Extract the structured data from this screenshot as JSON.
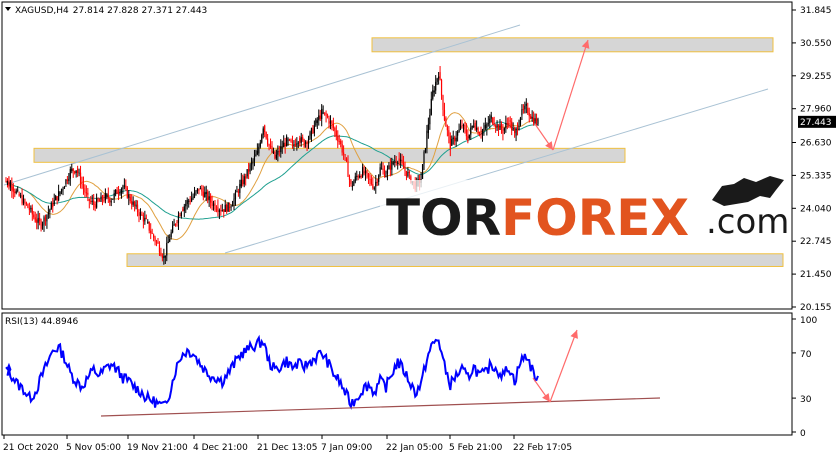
{
  "header": {
    "symbol": "XAGUSD,H4",
    "ohlc": "27.814 27.828 27.371 27.443"
  },
  "rsi_header": "RSI(13) 44.8946",
  "watermark": {
    "part1": "TOR",
    "part2": "FOREX",
    "part3": ".com"
  },
  "colors": {
    "candle_up": "#000000",
    "candle_down": "#ff0000",
    "ma_fast": "#e0a040",
    "ma_slow": "#20a090",
    "rsi_line": "#0000ff",
    "channel": "#a9c2d4",
    "zone_fill": "#d6d6d6",
    "zone_border": "#f0c040",
    "arrow": "#ff6b6b",
    "rsi_support": "#a05050",
    "logo_accent": "#e2541f"
  },
  "chart_data": [
    {
      "type": "candlestick",
      "symbol": "XAGUSD",
      "timeframe": "H4",
      "x_ticks": [
        "21 Oct 2020",
        "5 Nov 05:00",
        "19 Nov 21:00",
        "4 Dec 21:00",
        "21 Dec 13:05",
        "7 Jan 09:00",
        "22 Jan 05:00",
        "5 Feb 21:00",
        "22 Feb 17:05"
      ],
      "y_ticks": [
        "31.845",
        "30.550",
        "29.255",
        "27.960",
        "26.630",
        "25.335",
        "24.040",
        "22.745",
        "21.450",
        "20.155"
      ],
      "ylim": [
        20.155,
        31.845
      ],
      "current_price": "27.443",
      "close_series": [
        25.1,
        24.9,
        24.6,
        24.3,
        24.0,
        23.6,
        23.4,
        23.8,
        24.2,
        24.6,
        25.0,
        25.5,
        25.6,
        25.0,
        24.4,
        24.2,
        24.3,
        24.5,
        24.4,
        24.7,
        24.9,
        24.5,
        24.1,
        23.8,
        23.5,
        23.0,
        22.6,
        22.1,
        22.9,
        23.5,
        24.0,
        24.3,
        24.5,
        24.8,
        24.6,
        24.3,
        24.1,
        24.0,
        24.1,
        24.4,
        24.9,
        25.3,
        25.8,
        26.2,
        27.3,
        26.5,
        26.0,
        26.4,
        26.7,
        26.5,
        26.8,
        26.6,
        26.9,
        27.4,
        27.8,
        27.6,
        27.2,
        26.7,
        26.0,
        24.9,
        25.3,
        25.5,
        25.2,
        24.9,
        25.6,
        25.4,
        25.8,
        26.0,
        25.6,
        25.3,
        24.9,
        25.2,
        27.0,
        28.6,
        29.4,
        27.6,
        26.5,
        26.9,
        27.3,
        26.8,
        27.4,
        27.0,
        27.2,
        27.6,
        27.3,
        27.1,
        27.5,
        26.9,
        27.7,
        28.0,
        27.6,
        27.4
      ],
      "support_zones": [
        {
          "from": 30.2,
          "to": 30.75
        },
        {
          "from": 25.85,
          "to": 26.4
        },
        {
          "from": 21.75,
          "to": 22.25
        }
      ],
      "moving_averages": [
        "fast",
        "slow"
      ]
    },
    {
      "type": "line",
      "title": "RSI(13)",
      "value": "44.8946",
      "y_ticks": [
        "100",
        "70",
        "30",
        "0"
      ],
      "ylim": [
        0,
        100
      ],
      "levels": [
        30,
        70
      ],
      "values": [
        55,
        50,
        42,
        38,
        30,
        35,
        48,
        60,
        72,
        75,
        66,
        52,
        45,
        40,
        48,
        55,
        50,
        56,
        60,
        55,
        48,
        45,
        40,
        36,
        30,
        28,
        25,
        22,
        35,
        55,
        68,
        72,
        70,
        62,
        55,
        50,
        48,
        45,
        52,
        60,
        68,
        72,
        75,
        78,
        80,
        62,
        55,
        58,
        63,
        57,
        60,
        58,
        62,
        66,
        70,
        62,
        52,
        45,
        35,
        25,
        30,
        38,
        42,
        35,
        45,
        40,
        52,
        62,
        55,
        45,
        35,
        42,
        65,
        78,
        82,
        58,
        42,
        50,
        55,
        48,
        58,
        50,
        52,
        60,
        55,
        50,
        58,
        45,
        62,
        68,
        55,
        44.9
      ]
    }
  ]
}
